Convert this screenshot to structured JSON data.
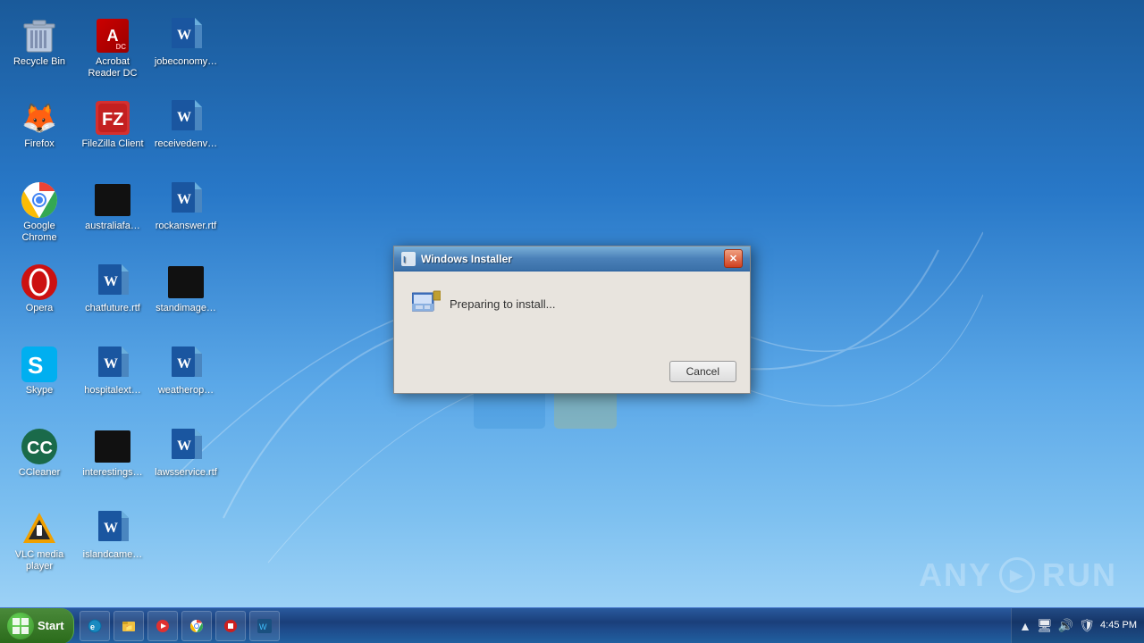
{
  "desktop": {
    "icons": [
      {
        "id": "recycle-bin",
        "label": "Recycle Bin",
        "type": "recycle"
      },
      {
        "id": "acrobat",
        "label": "Acrobat Reader DC",
        "type": "acrobat"
      },
      {
        "id": "jobeconomy",
        "label": "jobeconomy…",
        "type": "word"
      },
      {
        "id": "firefox",
        "label": "Firefox",
        "type": "firefox"
      },
      {
        "id": "filezilla",
        "label": "FileZilla Client",
        "type": "filezilla"
      },
      {
        "id": "receivedenv",
        "label": "receivedenv…",
        "type": "word"
      },
      {
        "id": "googlechrome",
        "label": "Google Chrome",
        "type": "chrome"
      },
      {
        "id": "australiafa",
        "label": "australiafa…",
        "type": "black"
      },
      {
        "id": "rockanswer",
        "label": "rockanswer.rtf",
        "type": "word"
      },
      {
        "id": "opera",
        "label": "Opera",
        "type": "opera"
      },
      {
        "id": "chatfuture",
        "label": "chatfuture.rtf",
        "type": "word"
      },
      {
        "id": "standimage",
        "label": "standimage…",
        "type": "black"
      },
      {
        "id": "skype",
        "label": "Skype",
        "type": "skype"
      },
      {
        "id": "hospitalext",
        "label": "hospitalext…",
        "type": "word"
      },
      {
        "id": "weatherop",
        "label": "weatherop…",
        "type": "word"
      },
      {
        "id": "ccleaner",
        "label": "CCleaner",
        "type": "ccleaner"
      },
      {
        "id": "interestings",
        "label": "interestings…",
        "type": "black"
      },
      {
        "id": "lawsservice",
        "label": "lawsservice.rtf",
        "type": "word"
      },
      {
        "id": "vlc",
        "label": "VLC media player",
        "type": "vlc"
      },
      {
        "id": "islandcame",
        "label": "islandcame…",
        "type": "word"
      }
    ]
  },
  "taskbar": {
    "start_label": "Start",
    "tray": {
      "time": "4:45 PM",
      "date": ""
    },
    "items": [
      {
        "id": "ie",
        "label": "Internet Explorer"
      },
      {
        "id": "explorer",
        "label": "File Explorer"
      },
      {
        "id": "wmp",
        "label": "Windows Media Player"
      },
      {
        "id": "chrome_task",
        "label": "Google Chrome"
      },
      {
        "id": "stop",
        "label": "Stop"
      },
      {
        "id": "wireshark",
        "label": "Wireshark"
      }
    ]
  },
  "dialog": {
    "title": "Windows Installer",
    "status_text": "Preparing to install...",
    "cancel_label": "Cancel"
  },
  "watermark": {
    "text": "ANY",
    "text2": "RUN"
  }
}
